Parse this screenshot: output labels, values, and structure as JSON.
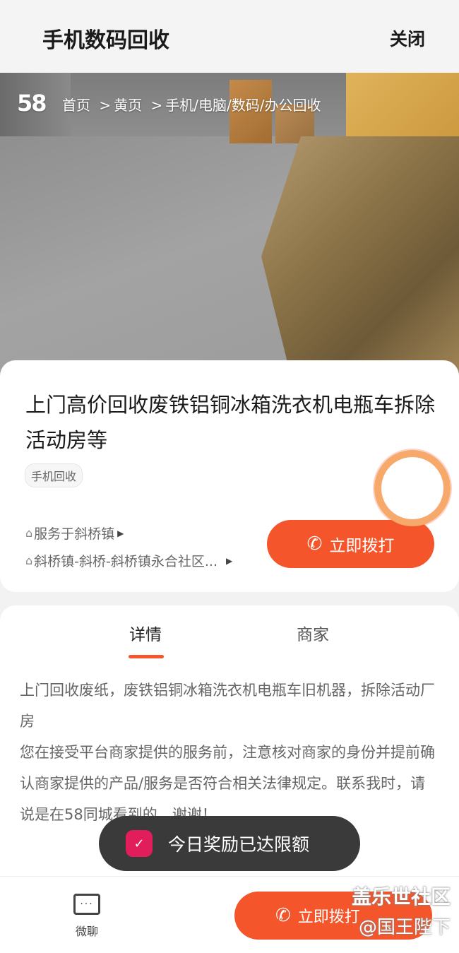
{
  "header": {
    "title": "手机数码回收",
    "close_label": "关闭"
  },
  "hero": {
    "logo": "58",
    "breadcrumbs": [
      "首页",
      "黄页",
      "手机/电脑/数码/办公回收"
    ],
    "separator": ">"
  },
  "listing": {
    "title": "上门高价回收废铁铝铜冰箱洗衣机电瓶车拆除活动房等",
    "tag": "手机回收",
    "service_area": "服务于斜桥镇",
    "address": "斜桥镇-斜桥-斜桥镇永合社区...",
    "call_label": "立即拨打"
  },
  "tabs": [
    {
      "label": "详情",
      "active": true
    },
    {
      "label": "商家",
      "active": false
    }
  ],
  "description": [
    "上门回收废纸，废铁铝铜冰箱洗衣机电瓶车旧机器，拆除活动厂房",
    "您在接受平台商家提供的服务前，注意核对商家的身份并提前确认商家提供的产品/服务是否符合相关法律规定。联系我时，请说是在58同城看到的，谢谢！"
  ],
  "toast": {
    "text": "今日奖励已达限额"
  },
  "bottom": {
    "chat_label": "微聊",
    "call_label": "立即拨打"
  },
  "watermark": {
    "line1": "盖乐世社区",
    "line2": "@国王陛下"
  },
  "colors": {
    "accent": "#f4552a",
    "toast_bg": "#3a3a3a",
    "toast_badge": "#e11d5c"
  }
}
